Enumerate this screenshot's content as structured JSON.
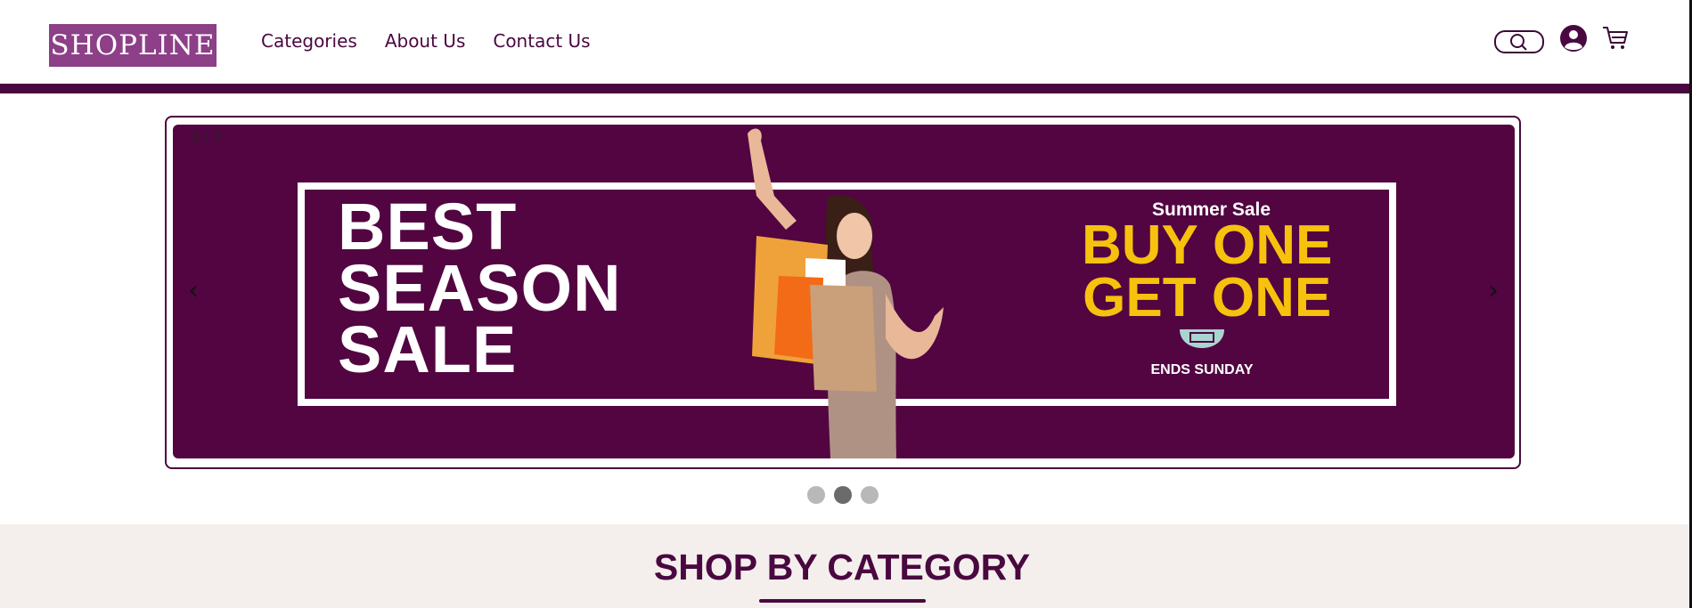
{
  "brand": {
    "logo_text": "SHOPLINE",
    "logo_color": "#8d3f88",
    "primary_color": "#4a0840"
  },
  "nav": {
    "items": [
      "Categories",
      "About Us",
      "Contact Us"
    ]
  },
  "header_icons": [
    "search-icon",
    "user-account-icon",
    "cart-icon"
  ],
  "carousel": {
    "counter": "2 / 3",
    "prev_label": "‹",
    "next_label": "›",
    "slide": {
      "headline": [
        "BEST",
        "SEASON",
        "SALE"
      ],
      "promo_kicker": "Summer Sale",
      "promo_main": [
        "BUY ONE",
        "GET ONE"
      ],
      "promo_badge": "ENDS SUNDAY",
      "background_color": "#520541",
      "promo_color": "#f6c20d"
    },
    "dots": 3,
    "active_dot": 2
  },
  "section": {
    "title": "SHOP BY CATEGORY"
  }
}
